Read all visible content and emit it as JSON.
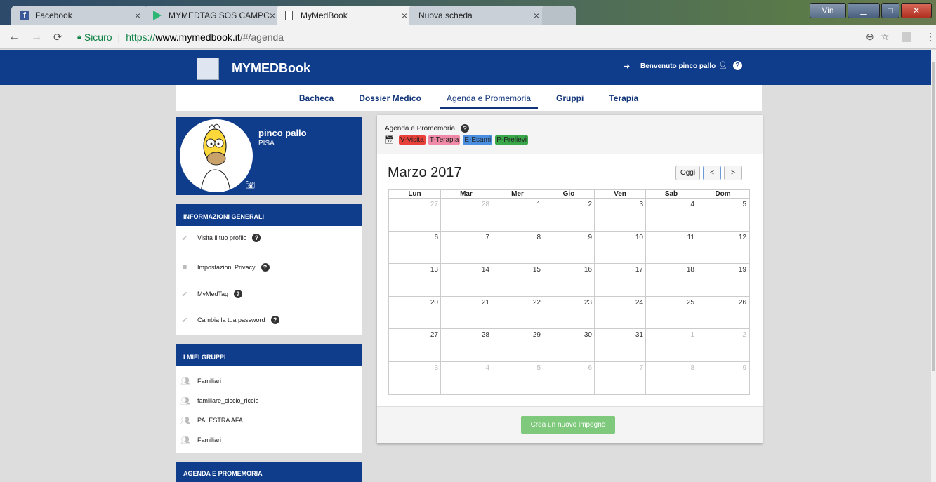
{
  "browser": {
    "tabs": [
      {
        "title": "Facebook"
      },
      {
        "title": "MYMEDTAG SOS CAMPC"
      },
      {
        "title": "MyMedBook"
      },
      {
        "title": "Nuova scheda"
      }
    ],
    "window_user": "Vin",
    "secure_label": "Sicuro",
    "url_prefix": "https://",
    "url_host": "www.mymedbook.it",
    "url_path": "/#/agenda"
  },
  "header": {
    "brand": "MYMEDBook",
    "welcome": "Benvenuto pinco pallo"
  },
  "menu": {
    "items": [
      {
        "label": "Bacheca"
      },
      {
        "label": "Dossier Medico"
      },
      {
        "label": "Agenda e Promemoria"
      },
      {
        "label": "Gruppi"
      },
      {
        "label": "Terapia"
      }
    ]
  },
  "profile": {
    "name": "pinco pallo",
    "city": "PISA"
  },
  "info_panel": {
    "title": "INFORMAZIONI GENERALI",
    "links": [
      {
        "label": "Visita il tuo profilo",
        "icon": "check-icon"
      },
      {
        "label": "Impostazioni Privacy",
        "icon": "lock-icon"
      },
      {
        "label": "MyMedTag",
        "icon": "check-icon"
      },
      {
        "label": "Cambia la tua password",
        "icon": "check-icon"
      }
    ]
  },
  "groups_panel": {
    "title": "I MIEI GRUPPI",
    "items": [
      {
        "label": "Familiari"
      },
      {
        "label": "familiare_ciccio_riccio"
      },
      {
        "label": "PALESTRA AFA"
      },
      {
        "label": "Familiari"
      }
    ]
  },
  "agenda_panel": {
    "title": "AGENDA E PROMEMORIA"
  },
  "calendar": {
    "heading": "Agenda e Promemoria",
    "legend": [
      {
        "label": "V-Visita",
        "color": "#e8413a"
      },
      {
        "label": "T-Terapia",
        "color": "#f08aa8"
      },
      {
        "label": "E-Esami",
        "color": "#4a8ee0"
      },
      {
        "label": "P-Prelievi",
        "color": "#3aa84a"
      }
    ],
    "month_title": "Marzo 2017",
    "today_label": "Oggi",
    "prev_label": "<",
    "next_label": ">",
    "weekdays": [
      "Lun",
      "Mar",
      "Mer",
      "Gio",
      "Ven",
      "Sab",
      "Dom"
    ],
    "weeks": [
      [
        {
          "d": "27",
          "o": true
        },
        {
          "d": "28",
          "o": true
        },
        {
          "d": "1"
        },
        {
          "d": "2"
        },
        {
          "d": "3"
        },
        {
          "d": "4"
        },
        {
          "d": "5"
        }
      ],
      [
        {
          "d": "6"
        },
        {
          "d": "7"
        },
        {
          "d": "8"
        },
        {
          "d": "9"
        },
        {
          "d": "10"
        },
        {
          "d": "11"
        },
        {
          "d": "12"
        }
      ],
      [
        {
          "d": "13"
        },
        {
          "d": "14"
        },
        {
          "d": "15"
        },
        {
          "d": "16"
        },
        {
          "d": "17"
        },
        {
          "d": "18"
        },
        {
          "d": "19"
        }
      ],
      [
        {
          "d": "20"
        },
        {
          "d": "21"
        },
        {
          "d": "22"
        },
        {
          "d": "23"
        },
        {
          "d": "24"
        },
        {
          "d": "25"
        },
        {
          "d": "26"
        }
      ],
      [
        {
          "d": "27"
        },
        {
          "d": "28"
        },
        {
          "d": "29"
        },
        {
          "d": "30"
        },
        {
          "d": "31"
        },
        {
          "d": "1",
          "o": true
        },
        {
          "d": "2",
          "o": true
        }
      ],
      [
        {
          "d": "3",
          "o": true
        },
        {
          "d": "4",
          "o": true
        },
        {
          "d": "5",
          "o": true
        },
        {
          "d": "6",
          "o": true
        },
        {
          "d": "7",
          "o": true
        },
        {
          "d": "8",
          "o": true
        },
        {
          "d": "9",
          "o": true
        }
      ]
    ],
    "new_button": "Crea un nuovo impegno"
  }
}
